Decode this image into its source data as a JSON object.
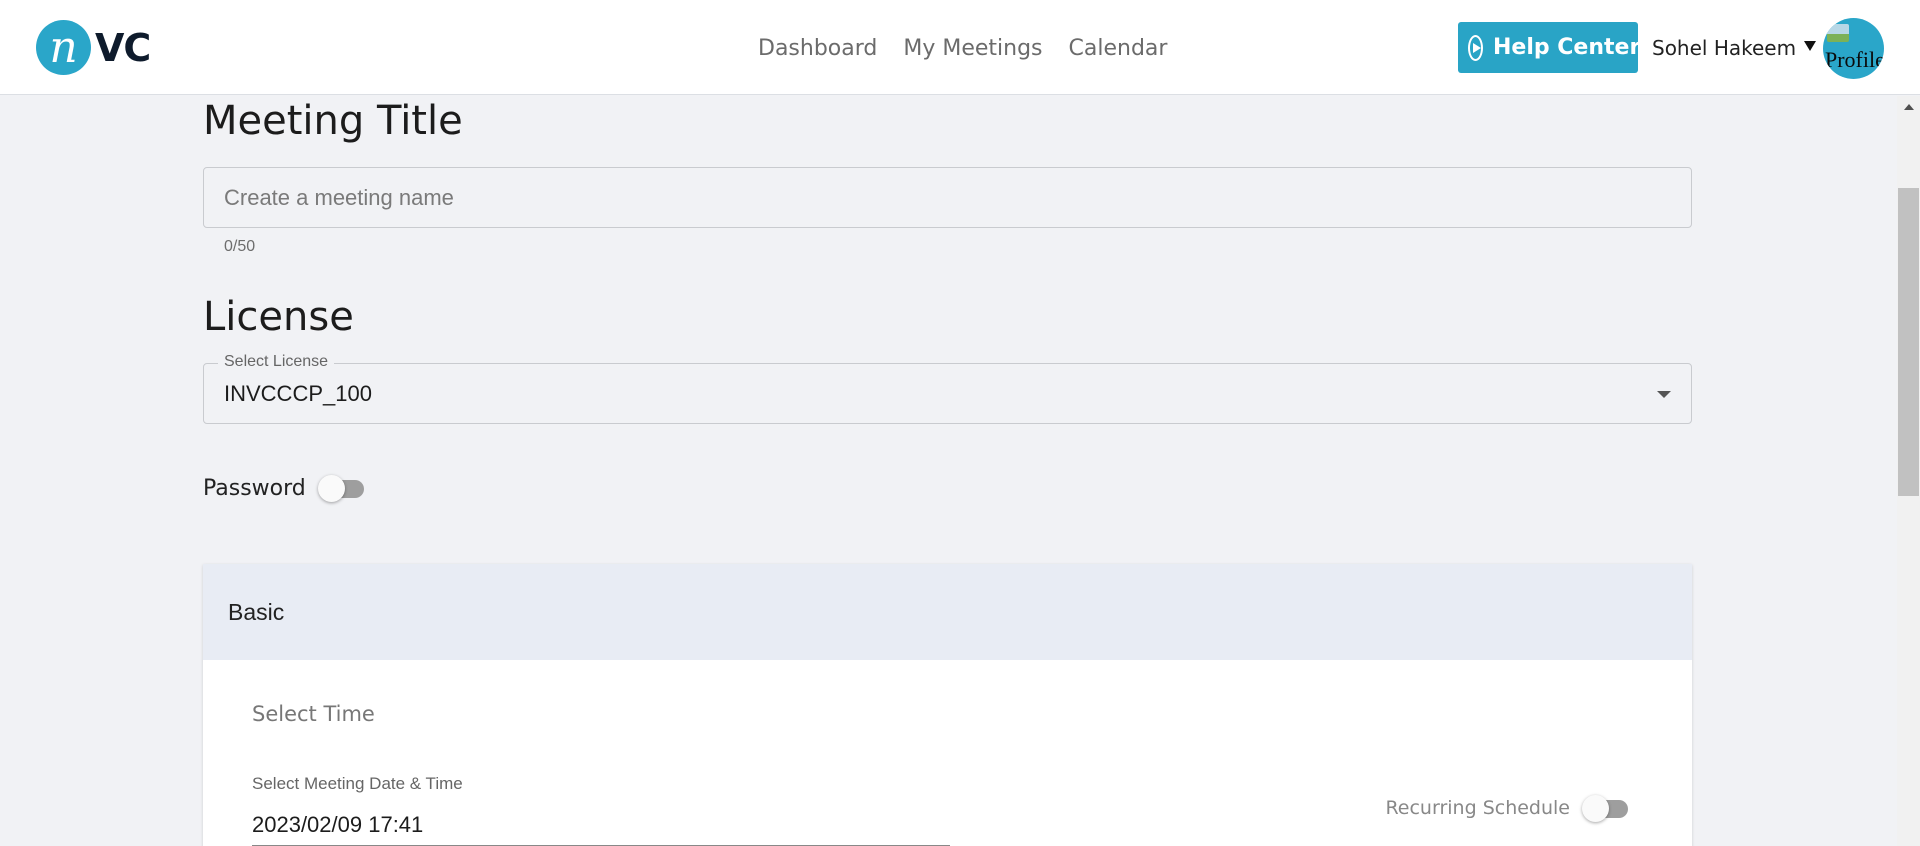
{
  "header": {
    "logo": {
      "mark": "n",
      "text": "VC"
    },
    "nav": [
      {
        "label": "Dashboard"
      },
      {
        "label": "My Meetings"
      },
      {
        "label": "Calendar"
      }
    ],
    "help_center": {
      "label": "Help Center",
      "icon": "play-circle-icon"
    },
    "user": {
      "name": "Sohel Hakeem"
    },
    "avatar": {
      "alt": "Profile"
    }
  },
  "form": {
    "meeting_title": {
      "heading": "Meeting Title",
      "placeholder": "Create a meeting name",
      "value": "",
      "counter": "0/50"
    },
    "license": {
      "heading": "License",
      "legend": "Select License",
      "selected": "INVCCCP_100"
    },
    "password": {
      "label": "Password",
      "enabled": false
    },
    "basic": {
      "header": "Basic",
      "select_time": "Select Time",
      "datetime_label": "Select Meeting Date & Time",
      "datetime_value": "2023/02/09 17:41",
      "recurring_label": "Recurring Schedule",
      "recurring_enabled": false
    }
  },
  "colors": {
    "accent": "#29a4c6",
    "page_bg": "#f1f2f5",
    "panel_header_bg": "#e8ecf4"
  }
}
